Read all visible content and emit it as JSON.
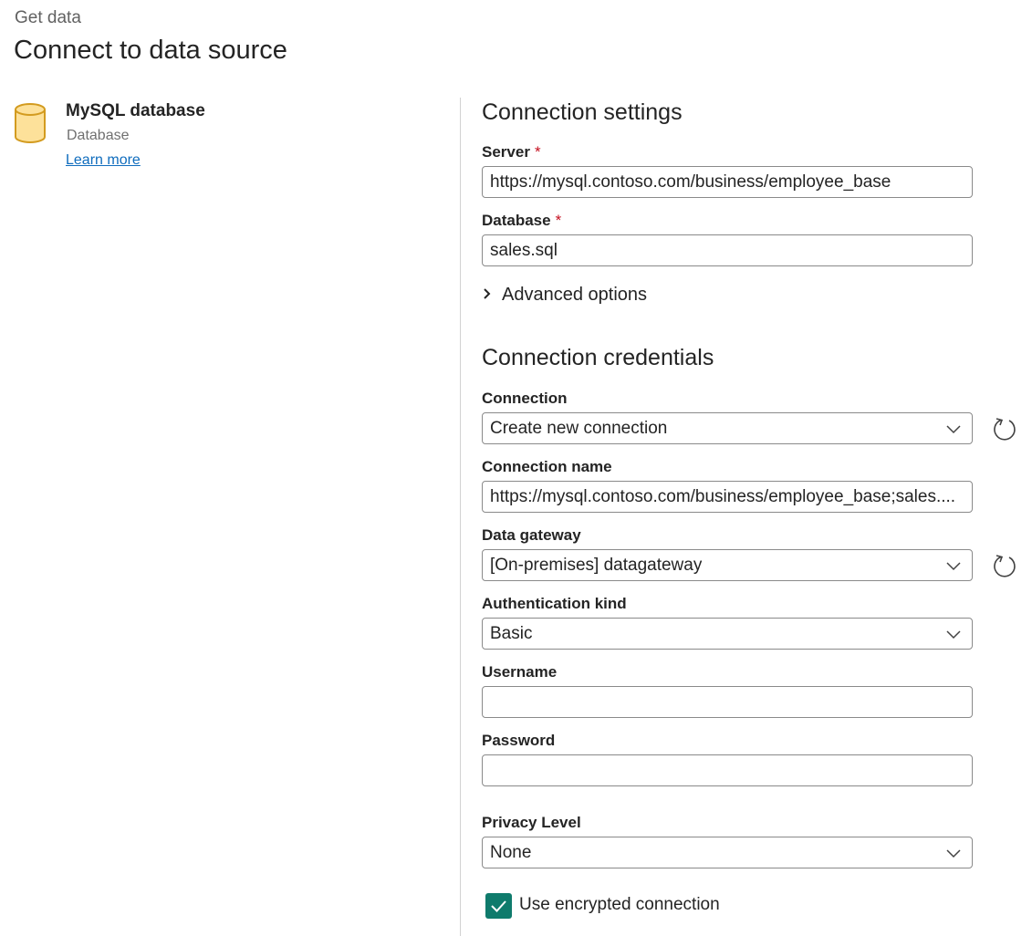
{
  "header": {
    "breadcrumb": "Get data",
    "title": "Connect to data source"
  },
  "source": {
    "icon": "database-cylinder-icon",
    "name": "MySQL database",
    "category": "Database",
    "learn_more": "Learn more"
  },
  "connection_settings": {
    "title": "Connection settings",
    "server_label": "Server",
    "server_value": "https://mysql.contoso.com/business/employee_base",
    "database_label": "Database",
    "database_value": "sales.sql",
    "required_marker": "*",
    "advanced_options": "Advanced options"
  },
  "credentials": {
    "title": "Connection credentials",
    "connection_label": "Connection",
    "connection_value": "Create new connection",
    "connection_name_label": "Connection name",
    "connection_name_value": "https://mysql.contoso.com/business/employee_base;sales....",
    "gateway_label": "Data gateway",
    "gateway_value": "[On-premises] datagateway",
    "auth_label": "Authentication kind",
    "auth_value": "Basic",
    "username_label": "Username",
    "username_value": "",
    "password_label": "Password",
    "password_value": "",
    "privacy_label": "Privacy Level",
    "privacy_value": "None",
    "encrypted_label": "Use encrypted connection",
    "encrypted_checked": true
  },
  "colors": {
    "accent": "#0f7b6c",
    "link": "#0f6cbd",
    "required": "#c50f1f",
    "icon_fill": "#fde19a",
    "icon_stroke": "#d39b1f"
  }
}
